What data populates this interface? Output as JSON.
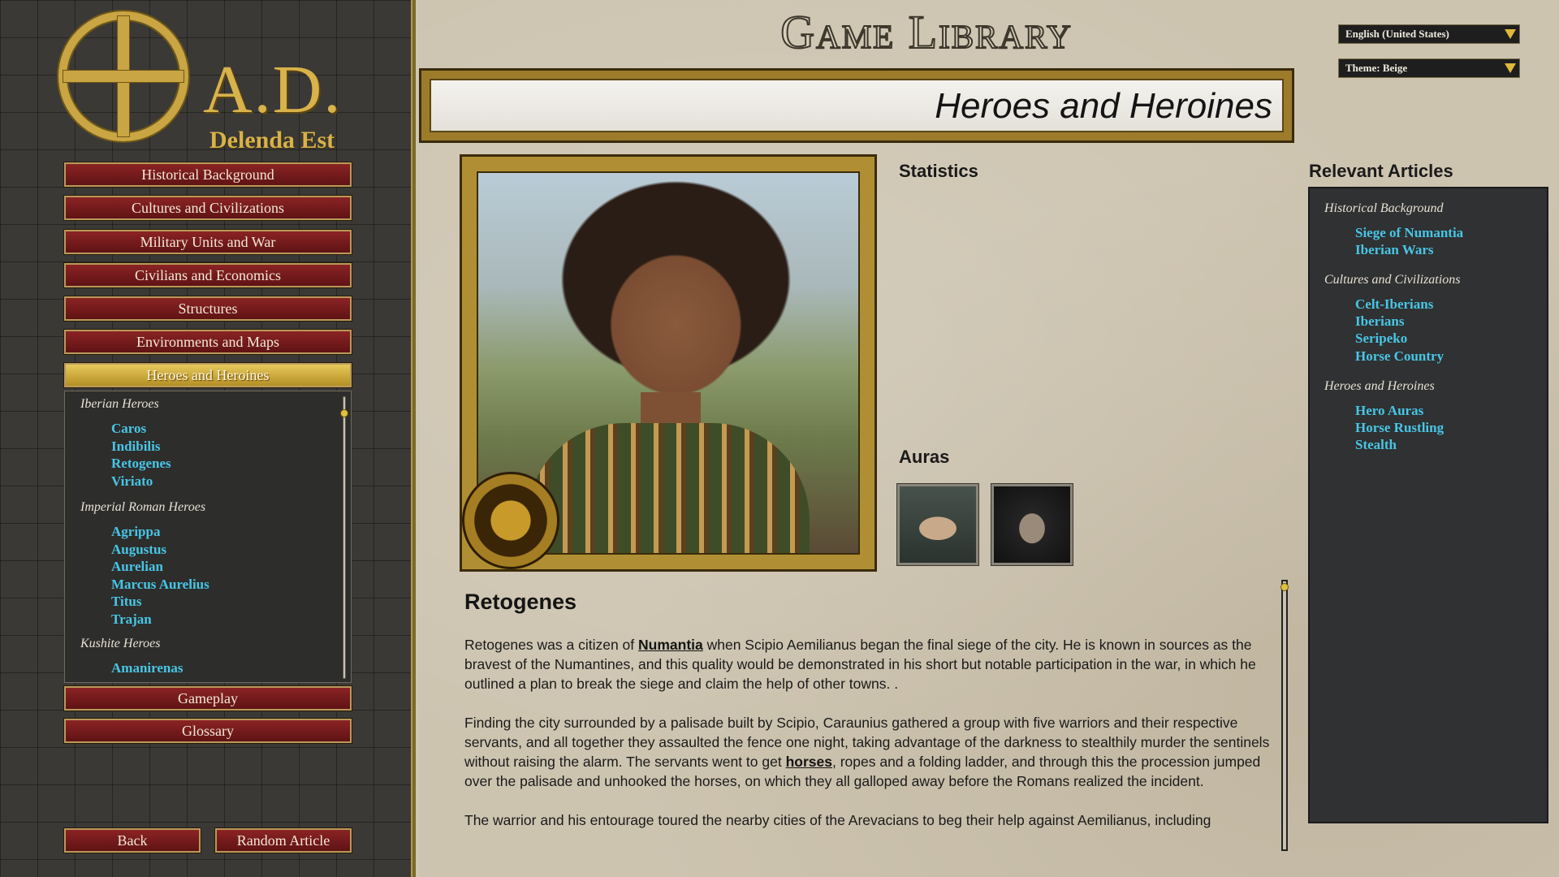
{
  "logo": {
    "title": "A.D.",
    "subtitle": "Delenda Est"
  },
  "header": {
    "title": "Game Library",
    "language_select": "English (United States)",
    "theme_select": "Theme: Beige"
  },
  "nav": {
    "items": [
      {
        "label": "Historical Background"
      },
      {
        "label": "Cultures and Civilizations"
      },
      {
        "label": "Military Units and War"
      },
      {
        "label": "Civilians and Economics"
      },
      {
        "label": "Structures"
      },
      {
        "label": "Environments and Maps"
      },
      {
        "label": "Heroes and Heroines",
        "active": true
      }
    ],
    "after": [
      {
        "label": "Gameplay"
      },
      {
        "label": "Glossary"
      }
    ]
  },
  "sublist": {
    "groups": [
      {
        "heading": "Iberian Heroes",
        "items": [
          "Caros",
          "Indibilis",
          "Retogenes",
          "Viriato"
        ]
      },
      {
        "heading": "Imperial Roman Heroes",
        "items": [
          "Agrippa",
          "Augustus",
          "Aurelian",
          "Marcus Aurelius",
          "Titus",
          "Trajan"
        ]
      },
      {
        "heading": "Kushite Heroes",
        "items": [
          "Amanirenas"
        ]
      }
    ]
  },
  "footer": {
    "back_label": "Back",
    "random_label": "Random Article"
  },
  "section": {
    "banner_title": "Heroes and Heroines"
  },
  "stats": {
    "heading": "Statistics",
    "auras_heading": "Auras"
  },
  "article": {
    "title": "Retogenes",
    "p1_a": "Retogenes was a citizen of ",
    "p1_link": "Numantia",
    "p1_b": " when Scipio Aemilianus began the final siege of the city. He is known in sources as the bravest of the Numantines, and this quality would be demonstrated in his short but notable participation in the war, in which he outlined a plan to break the siege and claim the help of other towns. .",
    "p2_a": "Finding the city surrounded by a palisade built by Scipio, Caraunius gathered a group with five warriors and their respective servants, and all together they assaulted the fence one night, taking advantage of the darkness to stealthily murder the sentinels without raising the alarm. The servants went to get ",
    "p2_link": "horses",
    "p2_b": ", ropes and a folding ladder, and through this the procession jumped over the palisade and unhooked the horses, on which they all galloped away before the Romans realized the incident.",
    "p3": "The warrior and his entourage toured the nearby cities of the Arevacians to beg their help against Aemilianus, including"
  },
  "relevant": {
    "heading": "Relevant Articles",
    "groups": [
      {
        "heading": "Historical Background",
        "items": [
          "Siege of Numantia",
          "Iberian Wars"
        ]
      },
      {
        "heading": "Cultures and Civilizations",
        "items": [
          "Celt-Iberians",
          "Iberians",
          "Seripeko",
          "Horse Country"
        ]
      },
      {
        "heading": "Heroes and Heroines",
        "items": [
          "Hero Auras",
          "Horse Rustling",
          "Stealth"
        ]
      }
    ]
  },
  "colors": {
    "accent_gold": "#c9a543",
    "link_cyan": "#48c6e6",
    "button_red": "#8b2324"
  },
  "icons": [
    "ankh-circle-logo-icon",
    "horse-aura-icon",
    "stealth-aura-icon",
    "bull-emblem-icon",
    "dropdown-arrow-icon"
  ]
}
